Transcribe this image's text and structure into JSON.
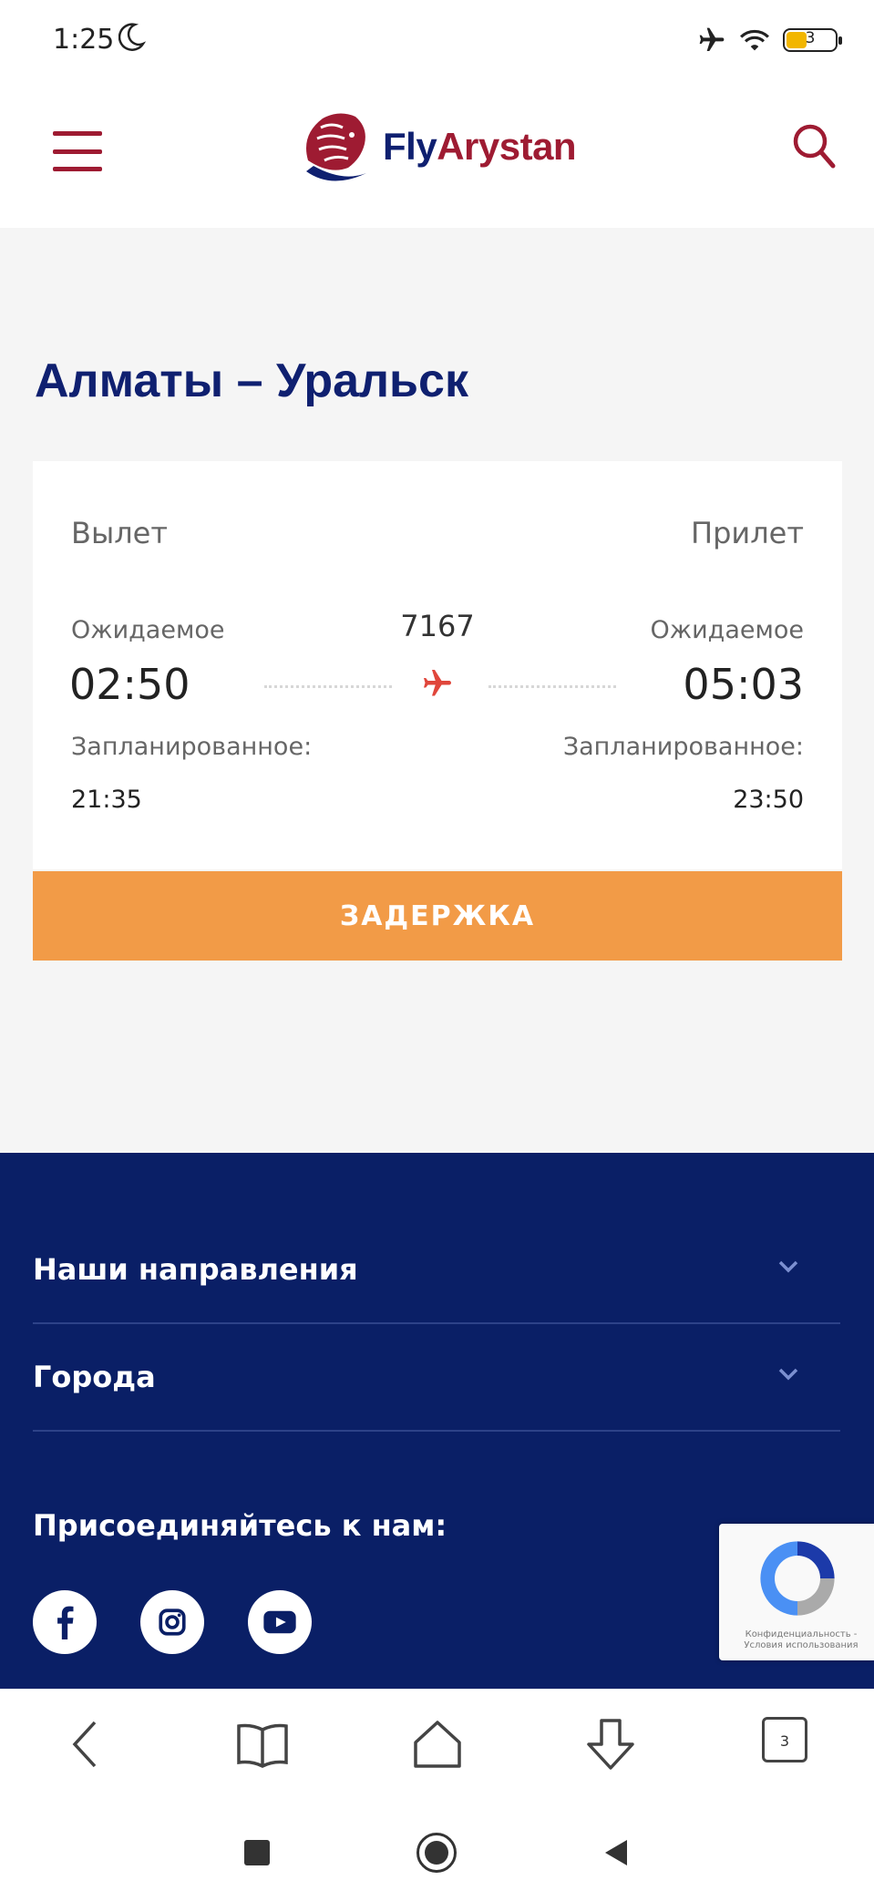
{
  "status_bar": {
    "time": "1:25",
    "battery": "3",
    "icons": [
      "moon-icon",
      "airplane-mode-icon",
      "wifi-icon",
      "battery-icon"
    ]
  },
  "header": {
    "logo": {
      "part1": "Fly",
      "part2": "Arystan"
    },
    "icons": [
      "menu-icon",
      "lion-logo",
      "search-icon"
    ],
    "colors": {
      "brand_red": "#9e1b32",
      "brand_blue": "#0f2070"
    }
  },
  "route": {
    "title": "Алматы – Уральск"
  },
  "flight": {
    "departure_label": "Вылет",
    "arrival_label": "Прилет",
    "expected_label": "Ожидаемое",
    "scheduled_label": "Запланированное:",
    "number": "7167",
    "departure": {
      "expected": "02:50",
      "scheduled": "21:35"
    },
    "arrival": {
      "expected": "05:03",
      "scheduled": "23:50"
    },
    "status": "ЗАДЕРЖКА",
    "status_color": "#f29b47"
  },
  "footer": {
    "sections": [
      {
        "label": "Наши направления"
      },
      {
        "label": "Города"
      }
    ],
    "join_label": "Присоединяйтесь к нам:",
    "social": [
      "facebook-icon",
      "instagram-icon",
      "youtube-icon"
    ],
    "background": "#0a1f66",
    "recaptcha_text": "Конфиденциальность - Условия использования"
  },
  "browser": {
    "tab_count": "3",
    "icons": [
      "back-icon",
      "bookmarks-icon",
      "home-icon",
      "download-icon",
      "tabs-icon"
    ]
  },
  "system_nav": {
    "icons": [
      "recents-icon",
      "home-circle-icon",
      "back-triangle-icon"
    ]
  }
}
